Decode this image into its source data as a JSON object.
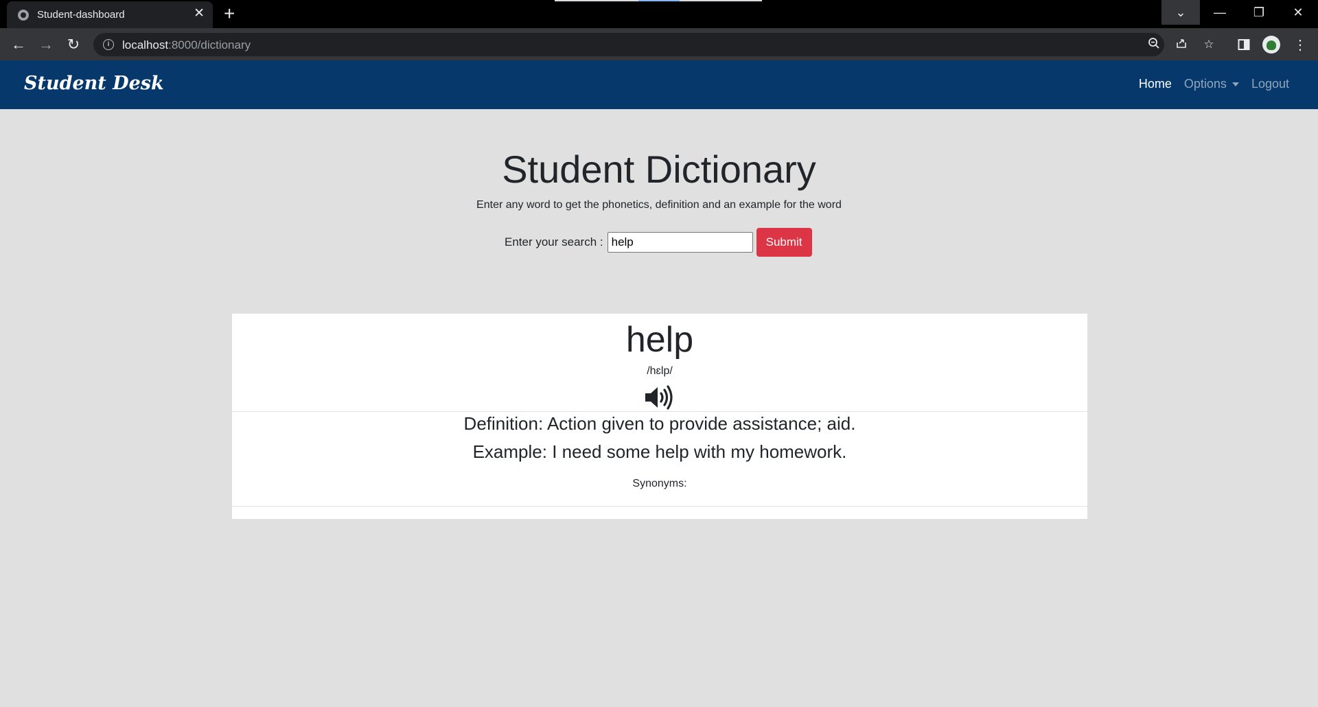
{
  "browser": {
    "tab_title": "Student-dashboard",
    "new_tab_symbol": "+",
    "url_host": "localhost",
    "url_path": ":8000/dictionary"
  },
  "navbar": {
    "brand": "Student Desk",
    "links": [
      "Home",
      "Options",
      "Logout"
    ]
  },
  "main": {
    "title": "Student Dictionary",
    "subtitle": "Enter any word to get the phonetics, definition and an example for the word",
    "search_label": "Enter your search :",
    "search_value": "help",
    "submit_label": "Submit"
  },
  "result": {
    "word": "help",
    "phonetic": "/hɛlp/",
    "definition": "Definition: Action given to provide assistance; aid.",
    "example": "Example: I need some help with my homework.",
    "synonyms": "Synonyms:"
  },
  "icons": [
    "back-icon",
    "forward-icon",
    "reload-icon",
    "info-icon",
    "zoom-icon",
    "share-icon",
    "star-icon",
    "sidepanel-icon",
    "menu-icon",
    "speaker-icon",
    "close-icon"
  ],
  "colors": {
    "navbar": "#06386c",
    "submit": "#dc3545",
    "page_bg": "#e0e0e0"
  }
}
